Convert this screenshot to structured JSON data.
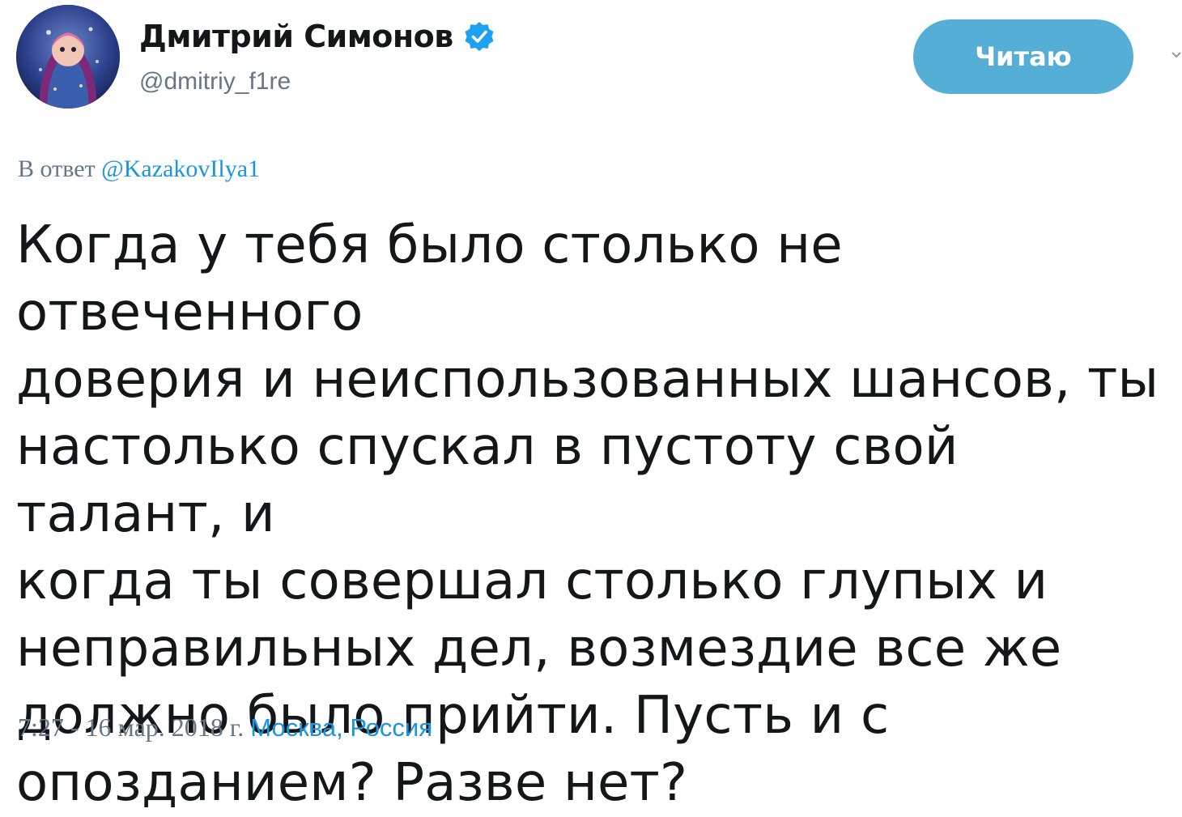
{
  "author": {
    "display_name": "Дмитрий Симонов",
    "handle": "@dmitriy_f1re",
    "verified": true,
    "avatar_icon": "avatar-portrait-icon"
  },
  "follow_button": {
    "label": "Читаю"
  },
  "reply": {
    "prefix": "В ответ",
    "mention": "@KazakovIlya1"
  },
  "tweet": {
    "text": "Когда у тебя было столько не отвеченного\nдоверия и неиспользованных шансов, ты\nнастолько спускал в пустоту свой талант, и\nкогда ты совершал столько глупых и\nнеправильных дел, возмездие все же\nдолжно было прийти. Пусть и с\nопозданием? Разве нет?"
  },
  "meta": {
    "time": "7:27 - 16 мар. 2018 г.",
    "location": "Москва, Россия"
  },
  "colors": {
    "accent": "#1b95e0",
    "button": "#55aed5",
    "muted": "#657786",
    "text": "#14171a"
  }
}
